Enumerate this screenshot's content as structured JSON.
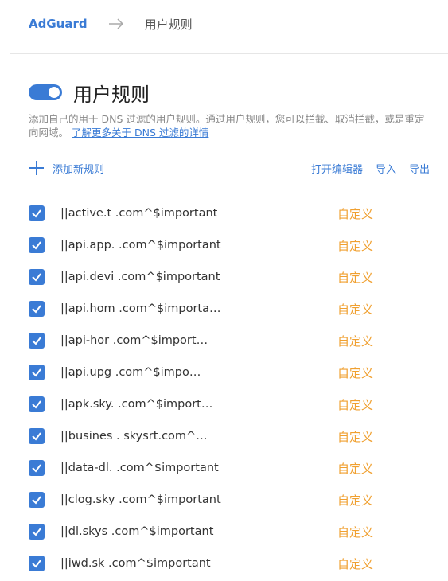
{
  "breadcrumb": {
    "home": "AdGuard",
    "current": "用户规则"
  },
  "header": {
    "title": "用户规则",
    "toggle_on": true
  },
  "description": {
    "text": "添加自己的用于 DNS 过滤的用户规则。通过用户规则，您可以拦截、取消拦截，或是重定向网域。",
    "link": "了解更多关于 DNS 过滤的详情"
  },
  "actions": {
    "add_rule": "添加新规则",
    "open_editor": "打开编辑器",
    "import": "导入",
    "export": "导出"
  },
  "colors": {
    "accent": "#3a7bd5",
    "tag": "#f0a030"
  },
  "rules": [
    {
      "text": "||active.t          .com^$important",
      "tag": "自定义"
    },
    {
      "text": "||api.app.          .com^$important",
      "tag": "自定义"
    },
    {
      "text": "||api.devi          .com^$important",
      "tag": "自定义"
    },
    {
      "text": "||api.hom           .com^$importa…",
      "tag": "自定义"
    },
    {
      "text": "||api-hor          .com^$import…",
      "tag": "自定义"
    },
    {
      "text": "||api.upg          .com^$impo…",
      "tag": "自定义"
    },
    {
      "text": "||apk.sky.         .com^$import…",
      "tag": "自定义"
    },
    {
      "text": "||busines      .  skysrt.com^…",
      "tag": "自定义"
    },
    {
      "text": "||data-dl.         .com^$important",
      "tag": "自定义"
    },
    {
      "text": "||clog.sky         .com^$important",
      "tag": "自定义"
    },
    {
      "text": "||dl.skys          .com^$important",
      "tag": "自定义"
    },
    {
      "text": "||iwd.sk            .com^$important",
      "tag": "自定义"
    }
  ]
}
